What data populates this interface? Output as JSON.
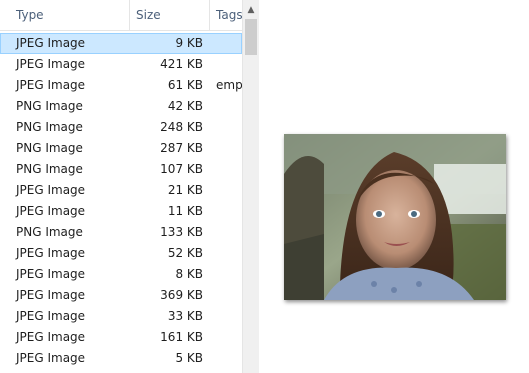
{
  "columns": {
    "type": "Type",
    "size": "Size",
    "tags": "Tags"
  },
  "rows": [
    {
      "type": "JPEG Image",
      "size": "9 KB",
      "tags": "",
      "selected": true
    },
    {
      "type": "JPEG Image",
      "size": "421 KB",
      "tags": ""
    },
    {
      "type": "JPEG Image",
      "size": "61 KB",
      "tags": "emp"
    },
    {
      "type": "PNG Image",
      "size": "42 KB",
      "tags": ""
    },
    {
      "type": "PNG Image",
      "size": "248 KB",
      "tags": ""
    },
    {
      "type": "PNG Image",
      "size": "287 KB",
      "tags": ""
    },
    {
      "type": "PNG Image",
      "size": "107 KB",
      "tags": ""
    },
    {
      "type": "JPEG Image",
      "size": "21 KB",
      "tags": ""
    },
    {
      "type": "JPEG Image",
      "size": "11 KB",
      "tags": ""
    },
    {
      "type": "PNG Image",
      "size": "133 KB",
      "tags": ""
    },
    {
      "type": "JPEG Image",
      "size": "52 KB",
      "tags": ""
    },
    {
      "type": "JPEG Image",
      "size": "8 KB",
      "tags": ""
    },
    {
      "type": "JPEG Image",
      "size": "369 KB",
      "tags": ""
    },
    {
      "type": "JPEG Image",
      "size": "33 KB",
      "tags": ""
    },
    {
      "type": "JPEG Image",
      "size": "161 KB",
      "tags": ""
    },
    {
      "type": "JPEG Image",
      "size": "5 KB",
      "tags": ""
    }
  ],
  "scrollbar": {
    "up_arrow_icon": "chevron-up-icon"
  },
  "colors": {
    "selection_bg": "#cce8ff",
    "selection_border": "#99d1ff",
    "header_text": "#4c607a"
  }
}
